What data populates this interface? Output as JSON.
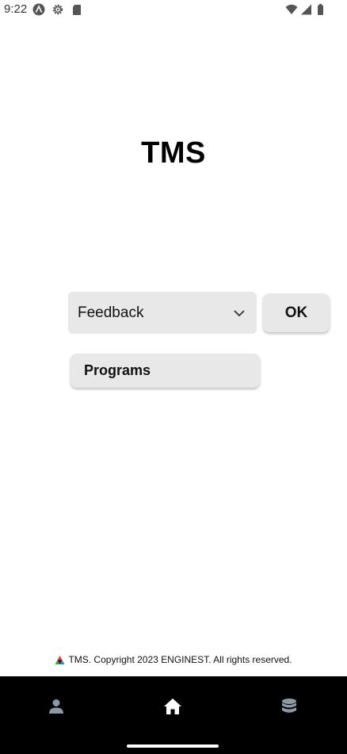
{
  "status_bar": {
    "time": "9:22",
    "left_icons": [
      "a-badge-icon",
      "settings-icon",
      "sd-card-icon"
    ],
    "right_icons": [
      "wifi-icon",
      "cell-signal-icon",
      "battery-icon"
    ]
  },
  "header": {
    "title": "TMS"
  },
  "form": {
    "dropdown_value": "Feedback",
    "ok_label": "OK",
    "programs_label": "Programs"
  },
  "footer": {
    "copyright": "TMS. Copyright 2023 ENGINEST. All rights reserved."
  },
  "bottom_nav": {
    "items": [
      {
        "icon": "person-icon",
        "active": false
      },
      {
        "icon": "home-icon",
        "active": true
      },
      {
        "icon": "database-icon",
        "active": false
      }
    ]
  },
  "colors": {
    "nav_background": "#000000",
    "nav_active": "#ffffff",
    "nav_inactive": "#8e99a8",
    "control_background": "#e8e8e8"
  }
}
